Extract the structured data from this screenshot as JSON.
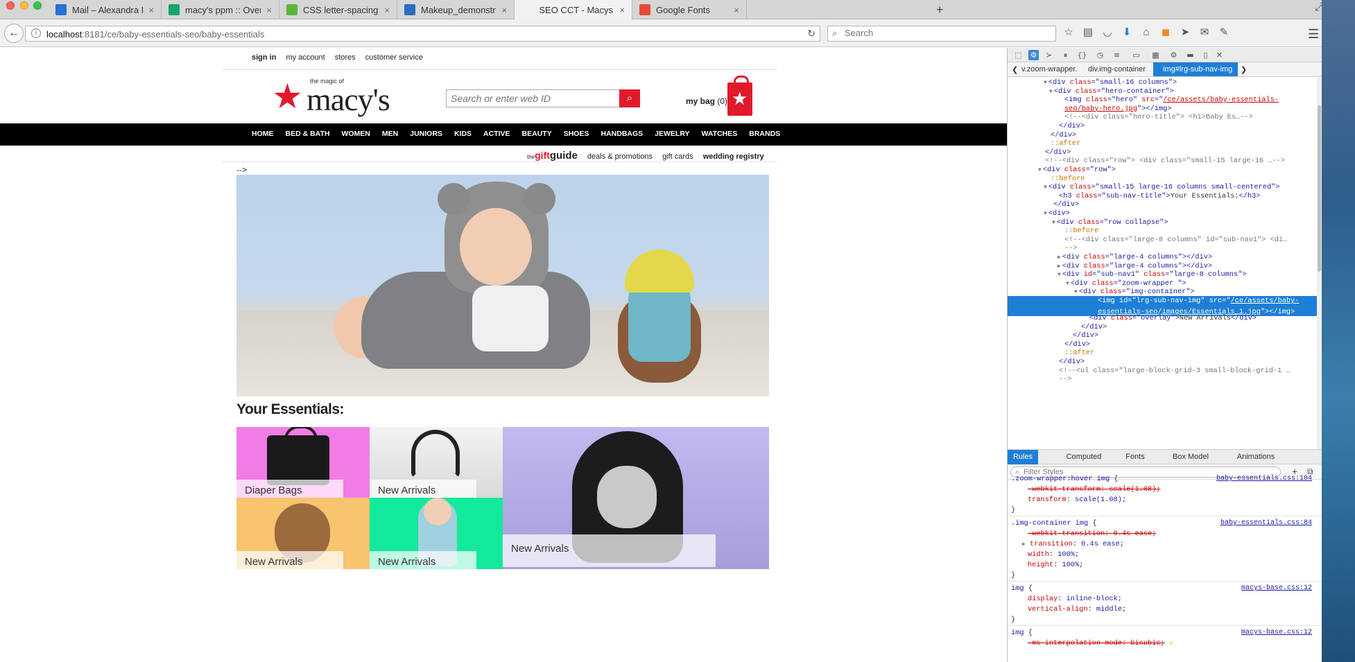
{
  "browser": {
    "tabs": [
      {
        "title": "Mail – Alexandra Estrada …",
        "icon": "mail-icon",
        "color": "#2a6fd6"
      },
      {
        "title": "macy's ppm :: Overview: G…",
        "icon": "ca-icon",
        "color": "#1aa36d"
      },
      {
        "title": "CSS letter-spacing property",
        "icon": "w3-icon",
        "color": "#5ab63b"
      },
      {
        "title": "Makeup_demonstration_at…",
        "icon": "house-icon",
        "color": "#2d6cc0"
      },
      {
        "title": "SEO CCT - Macys",
        "icon": "page-icon",
        "color": "#f2f2f2"
      },
      {
        "title": "Google Fonts",
        "icon": "fonts-icon",
        "color": "#e44c3a"
      }
    ],
    "close_glyph": "×",
    "new_tab_glyph": "+",
    "url_host": "localhost",
    "url_path": ":8181/ce/baby-essentials-seo/baby-essentials",
    "search_placeholder": "Search"
  },
  "site": {
    "util_links": [
      "sign in",
      "my account",
      "stores",
      "customer service"
    ],
    "logo_tagline": "the magic of",
    "logo_word": "macy's",
    "search_placeholder": "Search or enter web ID",
    "bag_label": "my bag",
    "bag_count": "(0)",
    "nav": [
      "HOME",
      "BED & BATH",
      "WOMEN",
      "MEN",
      "JUNIORS",
      "KIDS",
      "ACTIVE",
      "BEAUTY",
      "SHOES",
      "HANDBAGS",
      "JEWELRY",
      "WATCHES",
      "BRANDS"
    ],
    "promo": {
      "gift_prefix": "the",
      "gift_a": "gift",
      "gift_b": "guide",
      "deals": "deals & promotions",
      "cards": "gift cards",
      "registry": "wedding registry"
    },
    "stray_text": "-->",
    "essentials_title": "Your Essentials:",
    "tiles": [
      {
        "label": "Diaper Bags",
        "color": "#f27ce5"
      },
      {
        "label": "New Arrivals",
        "color": "#dcdcdc"
      },
      {
        "label": "New Arrivals",
        "color": "#f7c46f"
      },
      {
        "label": "New Arrivals",
        "color": "#12e99a"
      },
      {
        "label": "New Arrivals",
        "color": "#b4acea"
      }
    ],
    "brand_red": "#e11a2b"
  },
  "devtools": {
    "crumbs": [
      "v.zoom-wrapper.",
      "div.img-container",
      "img#lrg-sub-nav-img"
    ],
    "tree": [
      {
        "indent": 62,
        "tw": "▼",
        "parts": [
          [
            "tg",
            "<div "
          ],
          [
            "an",
            "class"
          ],
          [
            "tg",
            "=\""
          ],
          [
            "av",
            "small-16 columns"
          ],
          [
            "tg",
            "\">"
          ]
        ]
      },
      {
        "indent": 70,
        "tw": "▼",
        "parts": [
          [
            "tg",
            "<div "
          ],
          [
            "an",
            "class"
          ],
          [
            "tg",
            "=\""
          ],
          [
            "av",
            "hero-container"
          ],
          [
            "tg",
            "\">"
          ]
        ]
      },
      {
        "indent": 82,
        "tw": "",
        "parts": [
          [
            "tg",
            "<img "
          ],
          [
            "an",
            "class"
          ],
          [
            "tg",
            "=\""
          ],
          [
            "av",
            "hero"
          ],
          [
            "tg",
            "\" "
          ],
          [
            "an",
            "src"
          ],
          [
            "tg",
            "=\""
          ],
          [
            "lk",
            "/ce/assets/baby-essentials-"
          ]
        ]
      },
      {
        "indent": 82,
        "tw": "",
        "parts": [
          [
            "lk",
            "seo/baby-hero.jpg"
          ],
          [
            "tg",
            "\"></img>"
          ]
        ]
      },
      {
        "indent": 82,
        "tw": "",
        "parts": [
          [
            "cm",
            "<!--<div class=\"hero-title\"> <h1>Baby Es…-->"
          ]
        ]
      },
      {
        "indent": 74,
        "tw": "",
        "parts": [
          [
            "tg",
            "</div>"
          ]
        ]
      },
      {
        "indent": 62,
        "tw": "",
        "parts": [
          [
            "tg",
            "</div>"
          ]
        ]
      },
      {
        "indent": 62,
        "tw": "",
        "parts": [
          [
            "ps",
            "::after"
          ]
        ]
      },
      {
        "indent": 54,
        "tw": "",
        "parts": [
          [
            "tg",
            "</div>"
          ]
        ]
      },
      {
        "indent": 54,
        "tw": "",
        "parts": [
          [
            "cm",
            "<!--<div class=\"row\"> <div class=\"small-15 large-16 …-->"
          ]
        ]
      },
      {
        "indent": 54,
        "tw": "▼",
        "parts": [
          [
            "tg",
            "<div "
          ],
          [
            "an",
            "class"
          ],
          [
            "tg",
            "=\""
          ],
          [
            "av",
            "row"
          ],
          [
            "tg",
            "\">"
          ]
        ]
      },
      {
        "indent": 62,
        "tw": "",
        "parts": [
          [
            "ps",
            "::before"
          ]
        ]
      },
      {
        "indent": 62,
        "tw": "▼",
        "parts": [
          [
            "tg",
            "<div "
          ],
          [
            "an",
            "class"
          ],
          [
            "tg",
            "=\""
          ],
          [
            "av",
            "small-15 large-16 columns small-centered"
          ],
          [
            "tg",
            "\">"
          ]
        ]
      },
      {
        "indent": 74,
        "tw": "",
        "parts": [
          [
            "tg",
            "<h3 "
          ],
          [
            "an",
            "class"
          ],
          [
            "tg",
            "=\""
          ],
          [
            "av",
            "sub-nav-title"
          ],
          [
            "tg",
            "\">"
          ],
          [
            "x",
            "Your Essentials:"
          ],
          [
            "tg",
            "</h3>"
          ]
        ]
      },
      {
        "indent": 66,
        "tw": "",
        "parts": [
          [
            "tg",
            "</div>"
          ]
        ]
      },
      {
        "indent": 62,
        "tw": "▼",
        "parts": [
          [
            "tg",
            "<div>"
          ]
        ]
      },
      {
        "indent": 74,
        "tw": "▼",
        "parts": [
          [
            "tg",
            "<div "
          ],
          [
            "an",
            "class"
          ],
          [
            "tg",
            "=\""
          ],
          [
            "av",
            "row collapse"
          ],
          [
            "tg",
            "\">"
          ]
        ]
      },
      {
        "indent": 82,
        "tw": "",
        "parts": [
          [
            "ps",
            "::before"
          ]
        ]
      },
      {
        "indent": 82,
        "tw": "",
        "parts": [
          [
            "cm",
            "<!--<div class=\"large-8 columns\" id=\"sub-nav1\"> <di…"
          ]
        ]
      },
      {
        "indent": 82,
        "tw": "",
        "parts": [
          [
            "cm",
            "-->"
          ]
        ]
      },
      {
        "indent": 82,
        "tw": "▶",
        "parts": [
          [
            "tg",
            "<div "
          ],
          [
            "an",
            "class"
          ],
          [
            "tg",
            "=\""
          ],
          [
            "av",
            "large-4 columns"
          ],
          [
            "tg",
            "\"></div>"
          ]
        ]
      },
      {
        "indent": 82,
        "tw": "▶",
        "parts": [
          [
            "tg",
            "<div "
          ],
          [
            "an",
            "class"
          ],
          [
            "tg",
            "=\""
          ],
          [
            "av",
            "large-4 columns"
          ],
          [
            "tg",
            "\"></div>"
          ]
        ]
      },
      {
        "indent": 82,
        "tw": "▼",
        "parts": [
          [
            "tg",
            "<div "
          ],
          [
            "an",
            "id"
          ],
          [
            "tg",
            "=\""
          ],
          [
            "av",
            "sub-nav1"
          ],
          [
            "tg",
            "\" "
          ],
          [
            "an",
            "class"
          ],
          [
            "tg",
            "=\""
          ],
          [
            "av",
            "large-8 columns"
          ],
          [
            "tg",
            "\">"
          ]
        ]
      },
      {
        "indent": 94,
        "tw": "▼",
        "parts": [
          [
            "tg",
            "<div "
          ],
          [
            "an",
            "class"
          ],
          [
            "tg",
            "=\""
          ],
          [
            "av",
            "zoom-wrapper "
          ],
          [
            "tg",
            "\">"
          ]
        ]
      },
      {
        "indent": 106,
        "tw": "▼",
        "parts": [
          [
            "tg",
            "<div "
          ],
          [
            "an",
            "class"
          ],
          [
            "tg",
            "=\""
          ],
          [
            "av",
            "img-container"
          ],
          [
            "tg",
            "\">"
          ]
        ]
      }
    ],
    "tree_selected": {
      "line1": [
        [
          "tg",
          "<img "
        ],
        [
          "an",
          "id"
        ],
        [
          "tg",
          "=\""
        ],
        [
          "av",
          "lrg-sub-nav-img"
        ],
        [
          "tg",
          "\" "
        ],
        [
          "an",
          "src"
        ],
        [
          "tg",
          "=\""
        ],
        [
          "lk",
          "/ce/assets/baby-"
        ]
      ],
      "line2": [
        [
          "lk",
          "essentials-seo/images/Essentials_1.jpg"
        ],
        [
          "tg",
          "\"></img>"
        ]
      ]
    },
    "tree_after": [
      {
        "indent": 118,
        "tw": "",
        "parts": [
          [
            "tg",
            "<div "
          ],
          [
            "an",
            "class"
          ],
          [
            "tg",
            "=\""
          ],
          [
            "av",
            "overlay"
          ],
          [
            "tg",
            "\">"
          ],
          [
            "x",
            "New Arrivals"
          ],
          [
            "tg",
            "</div>"
          ]
        ]
      },
      {
        "indent": 106,
        "tw": "",
        "parts": [
          [
            "tg",
            "</div>"
          ]
        ]
      },
      {
        "indent": 94,
        "tw": "",
        "parts": [
          [
            "tg",
            "</div>"
          ]
        ]
      },
      {
        "indent": 82,
        "tw": "",
        "parts": [
          [
            "tg",
            "</div>"
          ]
        ]
      },
      {
        "indent": 82,
        "tw": "",
        "parts": [
          [
            "ps",
            "::after"
          ]
        ]
      },
      {
        "indent": 74,
        "tw": "",
        "parts": [
          [
            "tg",
            "</div>"
          ]
        ]
      },
      {
        "indent": 74,
        "tw": "",
        "parts": [
          [
            "cm",
            "<!--<ul class=\"large-block-grid-3 small-block-grid-1 …"
          ]
        ]
      },
      {
        "indent": 74,
        "tw": "",
        "parts": [
          [
            "cm",
            "-->"
          ]
        ]
      }
    ],
    "tabs": [
      "Rules",
      "Computed",
      "Fonts",
      "Box Model",
      "Animations"
    ],
    "filter_placeholder": "Filter Styles",
    "rules": {
      "r0_selector": ".zoom-wrapper:hover img",
      "r0_src": "baby-essentials.css:104",
      "r0_p1": "-webkit-transform: scale(1.08);",
      "r0_p2_name": "transform",
      "r0_p2_val": "scale(1.08);",
      "r1_selector": ".img-container img",
      "r1_src": "baby-essentials.css:84",
      "r1_p1": "-webkit-transition: 0.4s ease;",
      "r1_p2_name": "transition",
      "r1_p2_val": "0.4s ease;",
      "r1_p3_name": "width",
      "r1_p3_val": "100%;",
      "r1_p4_name": "height",
      "r1_p4_val": "100%;",
      "r2_selector": "img",
      "r2_src": "macys-base.css:12",
      "r2_p1_name": "display",
      "r2_p1_val": "inline-block;",
      "r2_p2_name": "vertical-align",
      "r2_p2_val": "middle;",
      "r3_selector": "img",
      "r3_src": "macys-base.css:12",
      "r3_p1": "-ms-interpolation-mode: bicubic;"
    }
  }
}
